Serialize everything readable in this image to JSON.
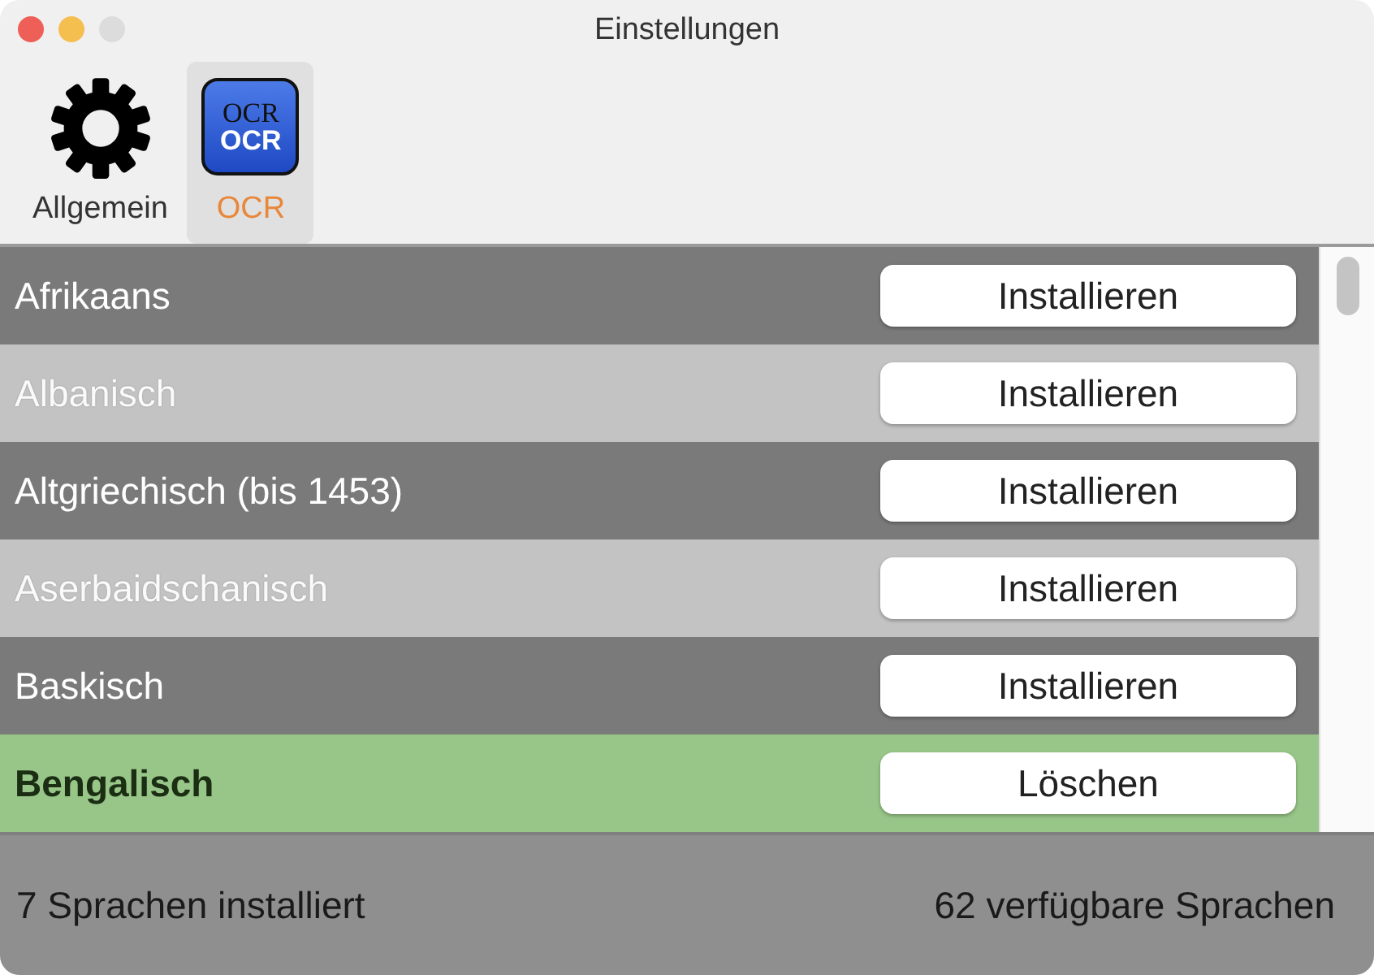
{
  "window": {
    "title": "Einstellungen"
  },
  "tabs": [
    {
      "label": "Allgemein",
      "kind": "gear",
      "selected": false
    },
    {
      "label": "OCR",
      "kind": "ocr",
      "icon_lines": [
        "OCR",
        "OCR"
      ],
      "selected": true
    }
  ],
  "languages": [
    {
      "name": "Afrikaans",
      "installed": false,
      "button": "Installieren"
    },
    {
      "name": "Albanisch",
      "installed": false,
      "button": "Installieren"
    },
    {
      "name": "Altgriechisch (bis 1453)",
      "installed": false,
      "button": "Installieren"
    },
    {
      "name": "Aserbaidschanisch",
      "installed": false,
      "button": "Installieren"
    },
    {
      "name": "Baskisch",
      "installed": false,
      "button": "Installieren"
    },
    {
      "name": "Bengalisch",
      "installed": true,
      "button": "Löschen"
    }
  ],
  "status_bar": {
    "installed_count": "7 Sprachen installiert",
    "available_count": "62 verfügbare Sprachen"
  }
}
